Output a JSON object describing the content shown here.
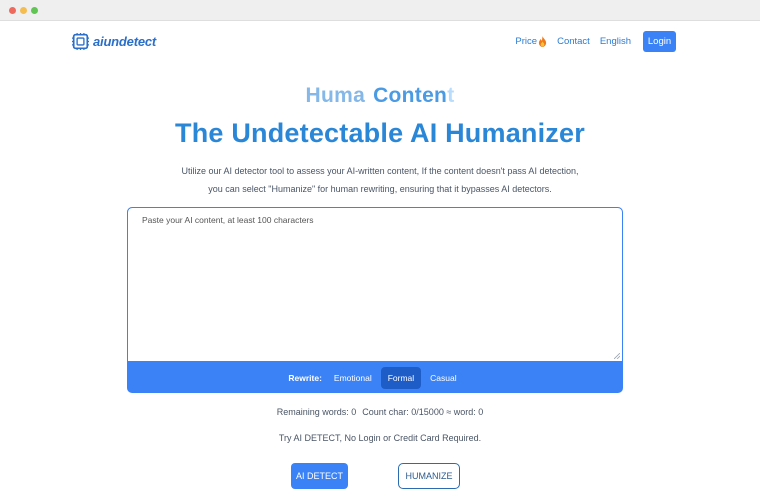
{
  "window": {
    "controls": [
      "close",
      "minimize",
      "maximize"
    ]
  },
  "header": {
    "brand": "aiundetect",
    "logo_icon": "aiundetect-logo-icon",
    "nav": {
      "price": "Price",
      "price_icon": "fire-icon",
      "contact": "Contact",
      "language": "English",
      "login": "Login"
    }
  },
  "hero": {
    "typing_word1": "Huma",
    "typing_word2": "Conten",
    "typing_word2_fade": "t",
    "headline": "The Undetectable AI Humanizer",
    "subtitle": "Utilize our AI detector tool to assess your AI-written content, If the content doesn't pass AI detection, you can select \"Humanize\" for human rewriting, ensuring that it bypasses AI detectors."
  },
  "editor": {
    "placeholder": "Paste your AI content, at least 100 characters",
    "value": "",
    "rewrite_label": "Rewrite:",
    "modes": [
      "Emotional",
      "Formal",
      "Casual"
    ],
    "selected_mode": "Formal"
  },
  "stats": {
    "remaining": "Remaining words: 0",
    "count": "Count char: 0/15000 ≈ word: 0"
  },
  "note": "Try AI DETECT, No Login or Credit Card Required.",
  "actions": {
    "detect": "AI DETECT",
    "humanize": "HUMANIZE"
  },
  "colors": {
    "primary": "#3b82f6",
    "heading": "#2a86d6",
    "active_mode": "#1e5cc8"
  }
}
